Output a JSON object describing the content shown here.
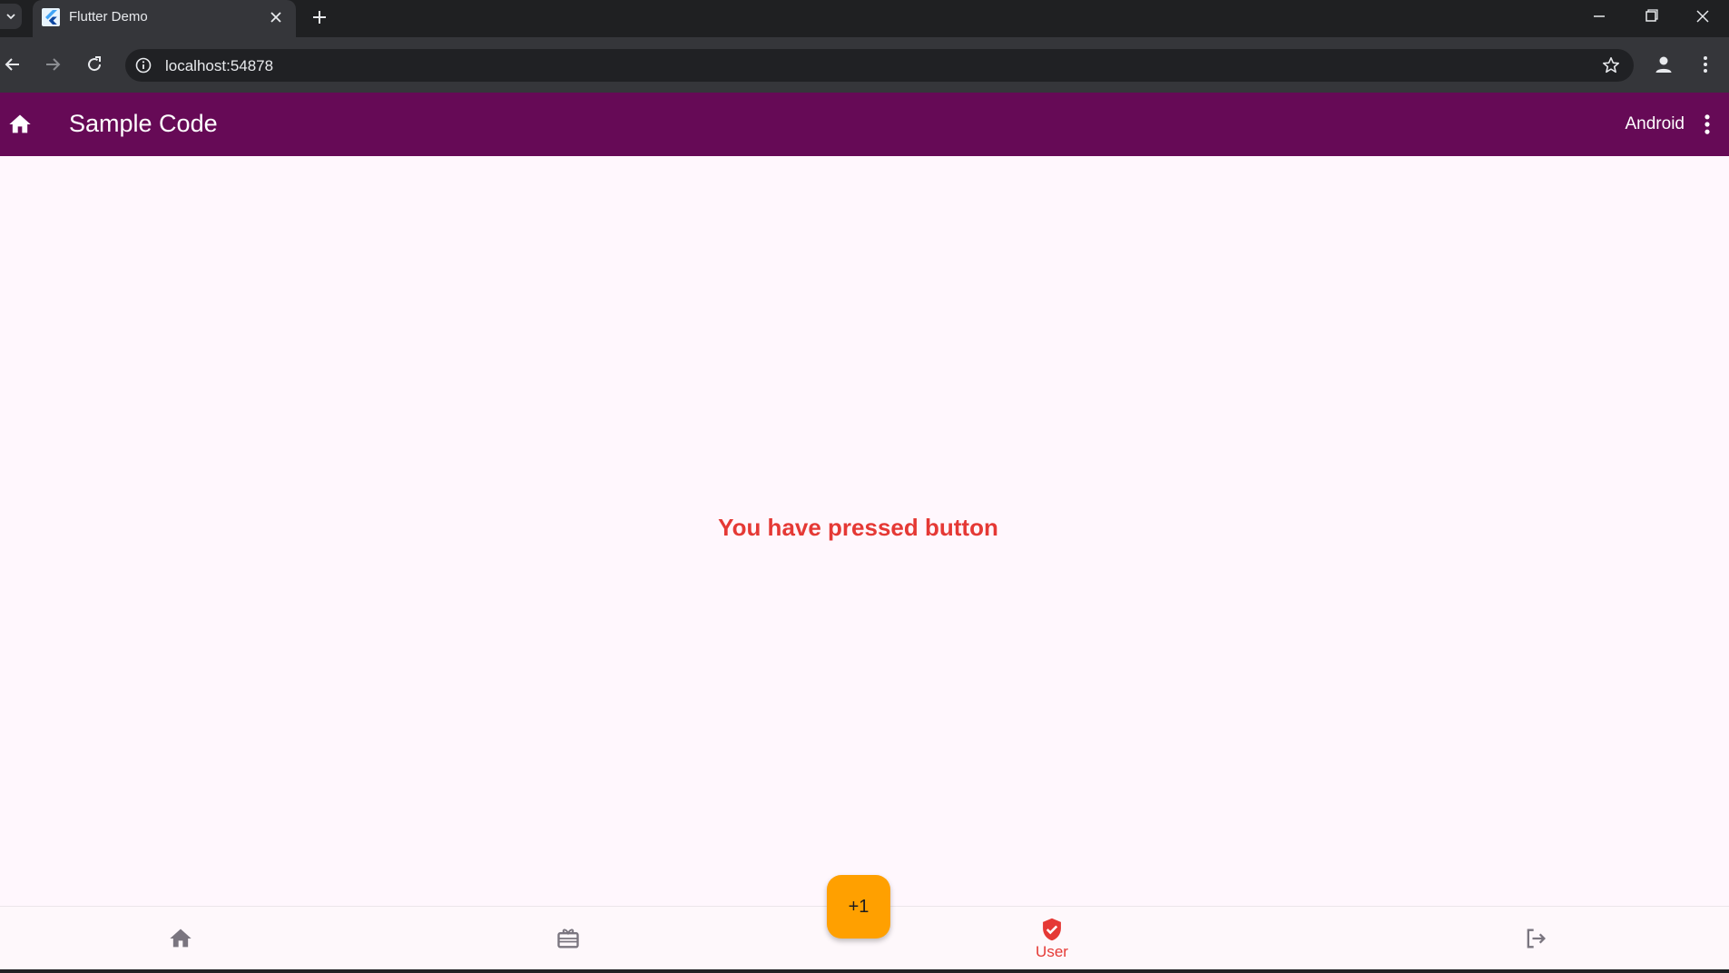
{
  "browser": {
    "tab_title": "Flutter Demo",
    "url": "localhost:54878"
  },
  "appbar": {
    "title": "Sample Code",
    "platform": "Android"
  },
  "main": {
    "message": "You have pressed button"
  },
  "fab": {
    "label": "+1"
  },
  "bottom_nav": {
    "items": [
      {
        "icon": "home-icon",
        "label": ""
      },
      {
        "icon": "card-giftcard-icon",
        "label": ""
      },
      {
        "icon": "verified-user-icon",
        "label": "User",
        "selected": true
      },
      {
        "icon": "logout-icon",
        "label": ""
      }
    ]
  },
  "colors": {
    "appbar": "#660a56",
    "accent_red": "#e53935",
    "fab": "#ffa000",
    "background": "#fff7fd"
  }
}
